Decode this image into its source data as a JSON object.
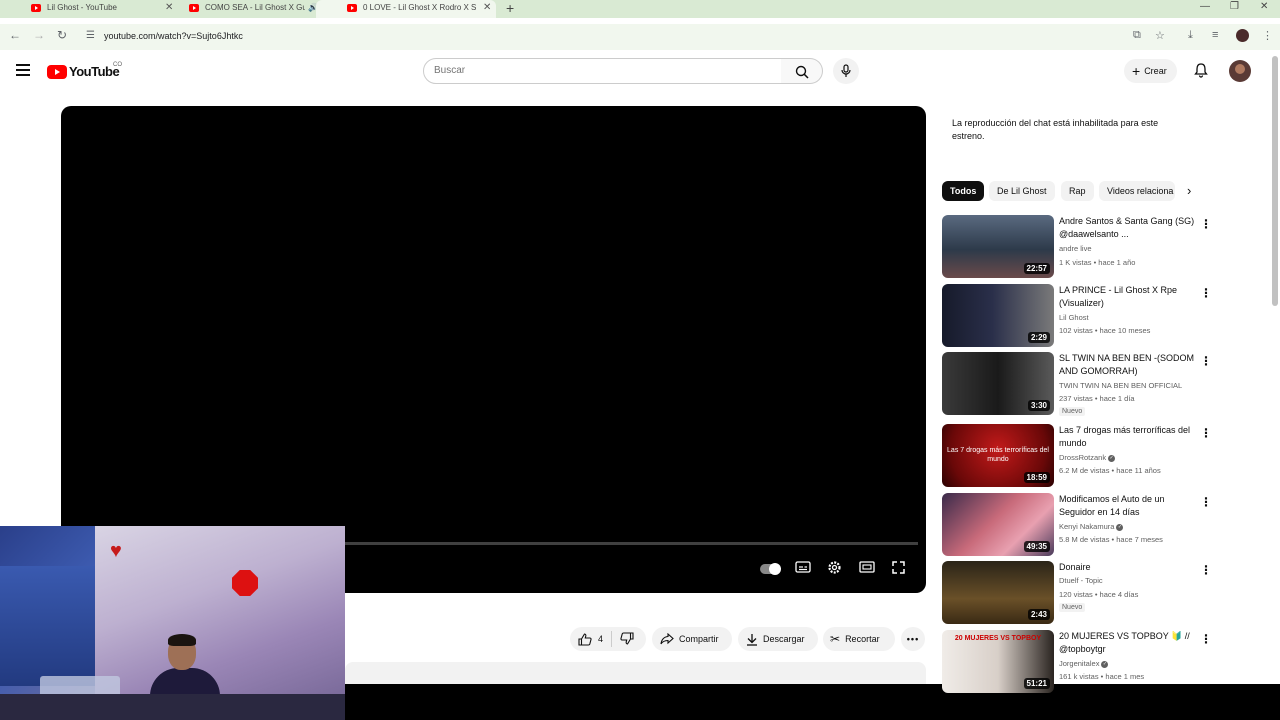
{
  "browser": {
    "tabs": [
      {
        "title": "Lil Ghost - YouTube",
        "active": false
      },
      {
        "title": "COMO SEA - Lil Ghost X Gu",
        "active": false
      },
      {
        "title": "0 LOVE - Lil Ghost X Rodro X Sy",
        "active": true
      }
    ],
    "url": "youtube.com/watch?v=Sujto6Jhtkc"
  },
  "header": {
    "logo_text": "YouTube",
    "country_code": "CO",
    "search_placeholder": "Buscar",
    "create_label": "Crear"
  },
  "actions": {
    "like_count": "4",
    "share_label": "Compartir",
    "download_label": "Descargar",
    "clip_label": "Recortar"
  },
  "chat_note": "La reproducción del chat está inhabilitada para este estreno.",
  "chips": [
    {
      "label": "Todos",
      "active": true
    },
    {
      "label": "De Lil Ghost",
      "active": false
    },
    {
      "label": "Rap",
      "active": false
    },
    {
      "label": "Videos relaciona",
      "active": false
    }
  ],
  "recommendations": [
    {
      "title": "Andre Santos & Santa Gang (SG) @daawelsanto ...",
      "channel": "andre live",
      "verified": false,
      "meta": "1 K vistas • hace 1 año",
      "duration": "22:57",
      "badge": "",
      "thumb_color": "#3b4a5c"
    },
    {
      "title": "LA PRINCE - Lil Ghost X Rpe (Visualizer)",
      "channel": "Lil Ghost",
      "verified": false,
      "meta": "102 vistas • hace 10 meses",
      "duration": "2:29",
      "badge": "",
      "thumb_color": "#1c1c22"
    },
    {
      "title": "SL TWIN NA BEN BEN -(SODOM AND GOMORRAH)",
      "channel": "TWIN TWIN NA BEN BEN OFFICIAL",
      "verified": false,
      "meta": "237 vistas • hace 1 día",
      "duration": "3:30",
      "badge": "Nuevo",
      "thumb_color": "#2a2a2a"
    },
    {
      "title": "Las 7 drogas más terroríficas del mundo",
      "channel": "DrossRotzank",
      "verified": true,
      "meta": "6.2 M de vistas • hace 11 años",
      "duration": "18:59",
      "badge": "",
      "thumb_color": "#8a0d0d",
      "thumb_text": "Las 7 drogas más terroríficas del mundo"
    },
    {
      "title": "Modificamos el Auto de un Seguidor en 14 días",
      "channel": "Kenyi Nakamura",
      "verified": true,
      "meta": "5.8 M de vistas • hace 7 meses",
      "duration": "49:35",
      "badge": "",
      "thumb_color": "#c86a7a"
    },
    {
      "title": "Donaire",
      "channel": "Dtuelf - Topic",
      "verified": false,
      "meta": "120 vistas • hace 4 días",
      "duration": "2:43",
      "badge": "Nuevo",
      "thumb_color": "#4a3a20"
    },
    {
      "title": "20 MUJERES VS TOPBOY 🔰 // @topboytgr",
      "channel": "Jorgenitalex",
      "verified": true,
      "meta": "161 k vistas • hace 1 mes",
      "duration": "51:21",
      "badge": "",
      "thumb_color": "#e8e4e0",
      "thumb_text": "20 MUJERES VS TOPBOY"
    }
  ],
  "colors": {
    "accent_red": "#ff0000",
    "tabbar_green": "#d9ead3"
  }
}
